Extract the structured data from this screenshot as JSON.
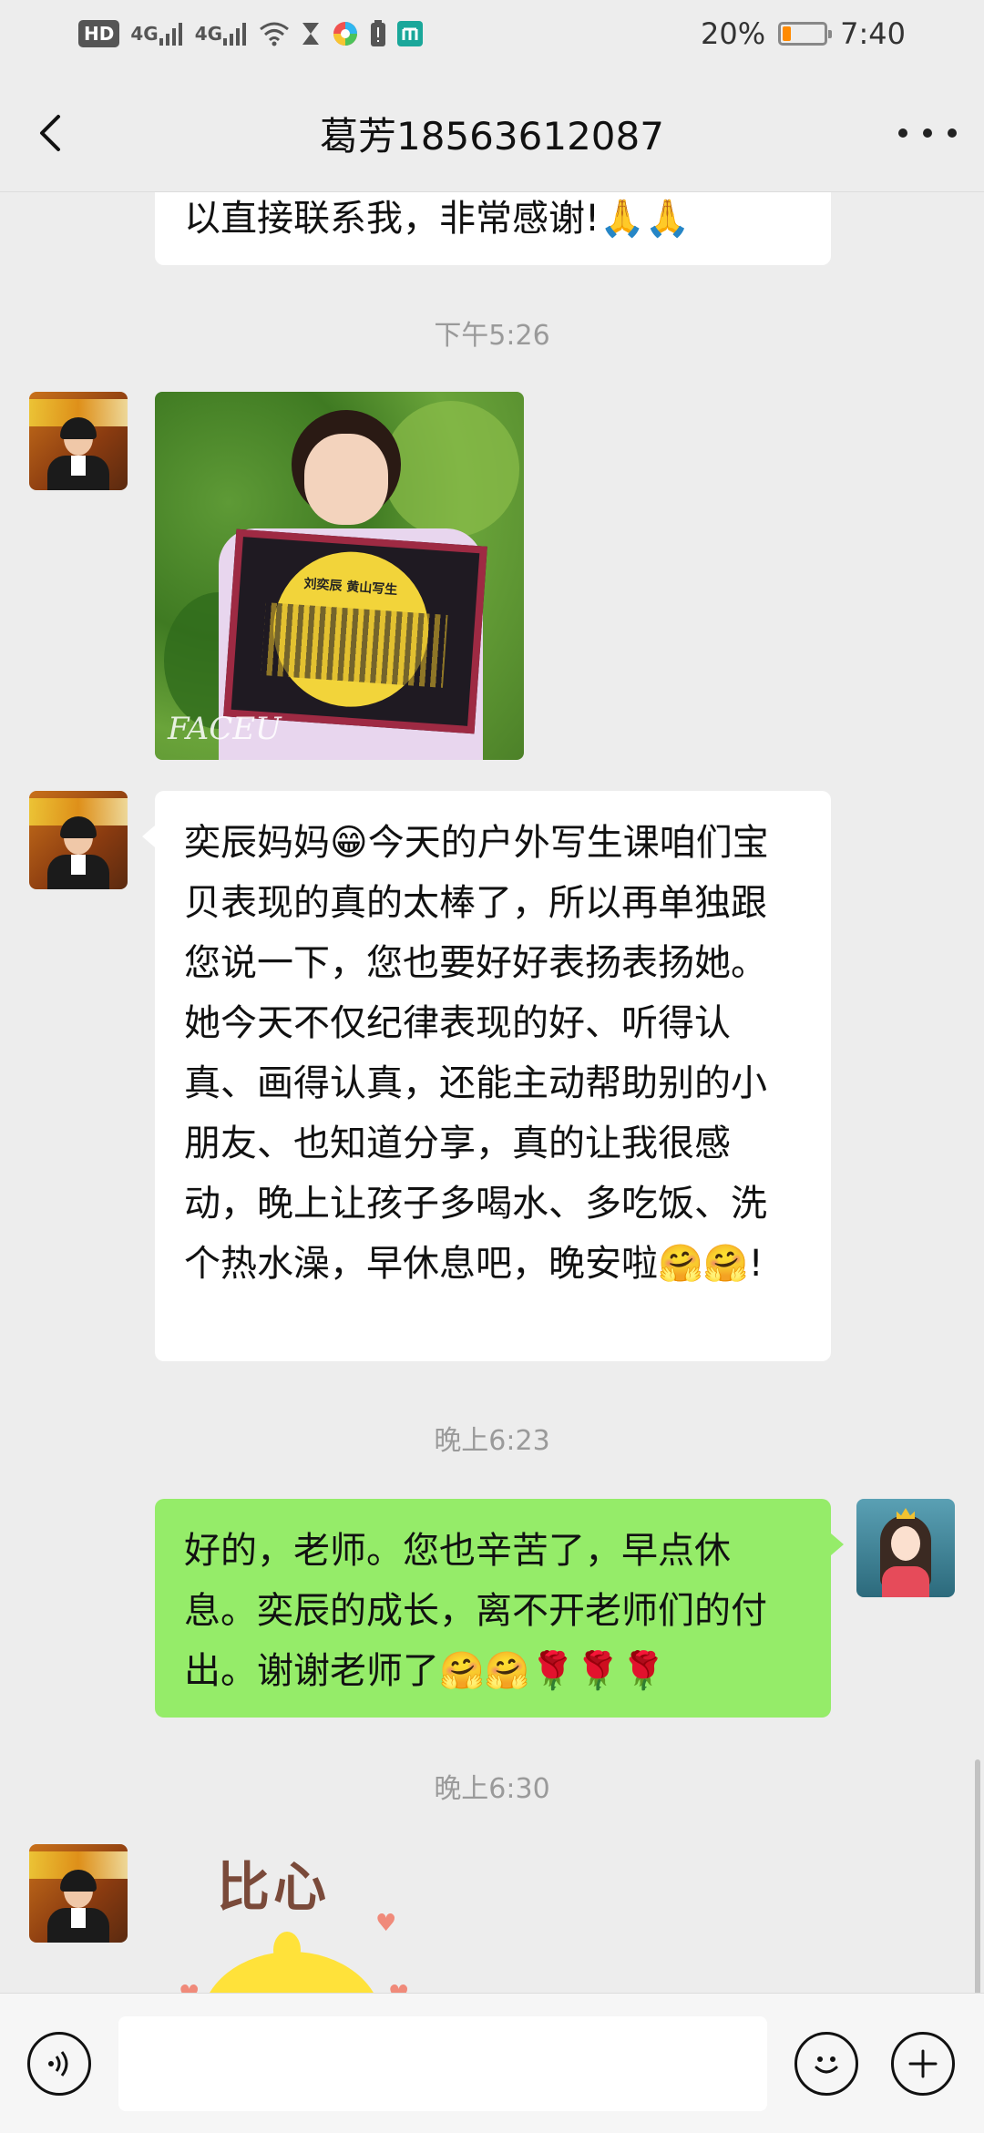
{
  "status_bar": {
    "hd": "HD",
    "signal1": "4G",
    "signal2": "4G",
    "battery_pct": "20%",
    "battery_level": 0.2,
    "time": "7:40",
    "icons": [
      "hd-icon",
      "signal-icon",
      "signal-icon",
      "wifi-icon",
      "hourglass-icon",
      "colorful-app-icon",
      "alert-battery-icon",
      "mi-icon"
    ]
  },
  "nav": {
    "title": "葛芳18563612087",
    "back_icon": "chevron-left-icon",
    "more_icon": "more-dots-icon"
  },
  "messages": {
    "m0_text": "以直接联系我，非常感谢!🙏🙏",
    "t1": "下午5:26",
    "m1_photo_watermark": "FACEU",
    "m1_board_text": "刘奕辰 黄山写生",
    "m2_text": "奕辰妈妈😁今天的户外写生课咱们宝贝表现的真的太棒了，所以再单独跟您说一下，您也要好好表扬表扬她。她今天不仅纪律表现的好、听得认真、画得认真，还能主动帮助别的小朋友、也知道分享，真的让我很感动，晚上让孩子多喝水、多吃饭、洗个热水澡，早休息吧，晚安啦🤗🤗!",
    "t2": "晚上6:23",
    "m3_text": "好的，老师。您也辛苦了，早点休息。奕辰的成长，离不开老师们的付出。谢谢老师了🤗🤗🌹🌹🌹",
    "t3": "晚上6:30",
    "m4_sticker_text": "比心"
  },
  "input_bar": {
    "voice_icon": "voice-icon",
    "input_value": "",
    "emoji_icon": "emoji-icon",
    "plus_icon": "plus-icon"
  },
  "colors": {
    "bg": "#ededed",
    "bubble_me": "#95ec69",
    "bubble_other": "#ffffff",
    "time_text": "#9a9a9a"
  }
}
